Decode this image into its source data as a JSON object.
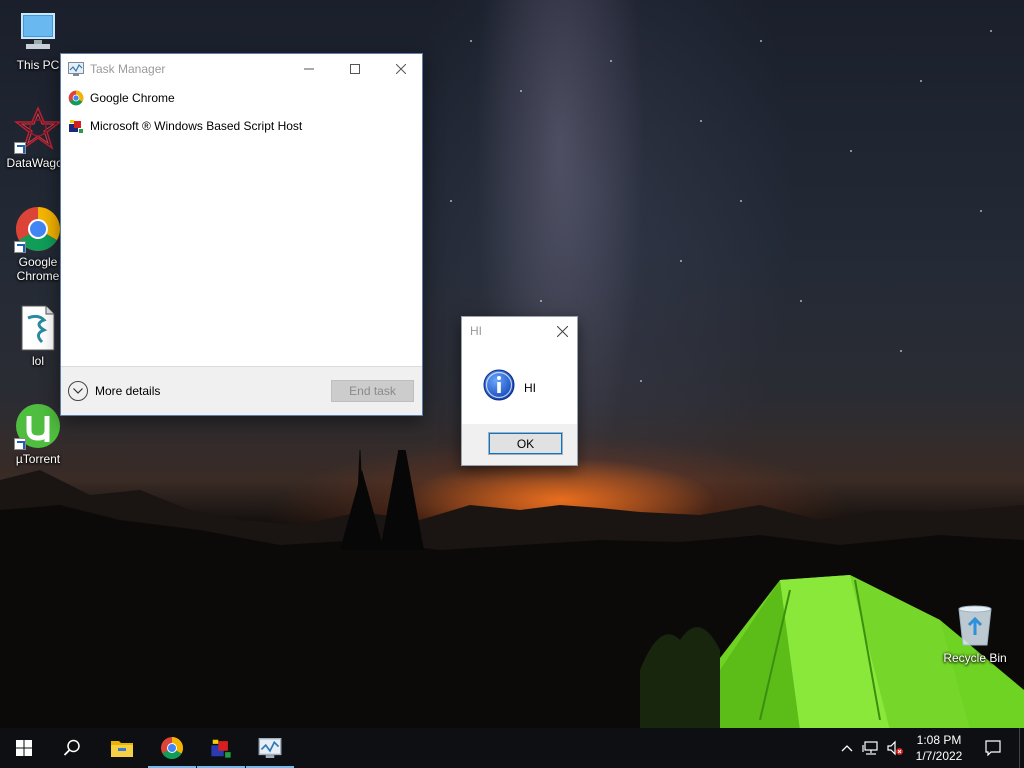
{
  "desktop": {
    "icons": [
      {
        "label": "This PC",
        "icon": "computer-icon"
      },
      {
        "label": "DataWagon",
        "icon": "datawagon-icon"
      },
      {
        "label": "Google Chrome",
        "icon": "chrome-icon"
      },
      {
        "label": "lol",
        "icon": "script-file-icon"
      },
      {
        "label": "µTorrent",
        "icon": "utorrent-icon"
      },
      {
        "label": "Recycle Bin",
        "icon": "recycle-bin-icon"
      }
    ]
  },
  "task_manager": {
    "title": "Task Manager",
    "processes": [
      {
        "name": "Google Chrome",
        "icon": "chrome-icon"
      },
      {
        "name": "Microsoft ® Windows Based Script Host",
        "icon": "script-host-icon"
      }
    ],
    "more_details_label": "More details",
    "end_task_label": "End task"
  },
  "message_box": {
    "title": "HI",
    "message": "HI",
    "ok_label": "OK"
  },
  "taskbar": {
    "pinned": [
      "start-icon",
      "search-icon",
      "file-explorer-icon",
      "chrome-icon",
      "script-host-icon",
      "task-manager-icon"
    ],
    "time": "1:08 PM",
    "date": "1/7/2022"
  },
  "colors": {
    "accent": "#0078d7",
    "taskbar": "#0d0f12",
    "tent_green": "#7cdc2a"
  }
}
